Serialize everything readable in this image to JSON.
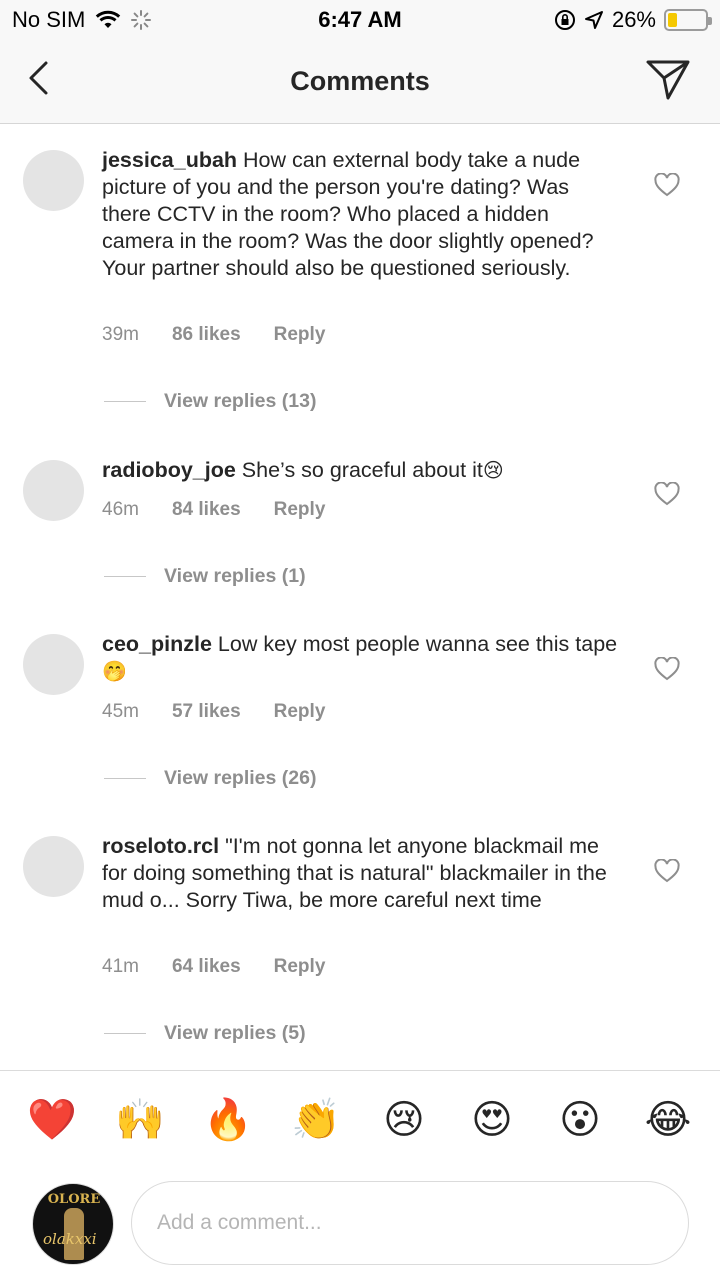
{
  "status_bar": {
    "carrier": "No SIM",
    "time": "6:47 AM",
    "battery": "26%",
    "battery_level": 0.26,
    "icons": [
      "wifi-icon",
      "loading-spinner-icon",
      "orientation-lock-icon",
      "location-arrow-icon",
      "battery-icon"
    ]
  },
  "nav": {
    "title": "Comments",
    "back_icon": "chevron-left-icon",
    "send_icon": "paper-plane-icon"
  },
  "comments": [
    {
      "username": "jessica_ubah",
      "text": "How can external body take a nude picture of you and the person you're dating? Was there CCTV in the room? Who placed a hidden camera in the room? Was the door slightly opened? Your partner should also be questioned seriously.",
      "emoji": "",
      "time": "39m",
      "likes": "86 likes",
      "reply": "Reply",
      "view_replies": "View replies (13)"
    },
    {
      "username": "radioboy_joe",
      "text": "She’s so graceful about it",
      "emoji": "😢",
      "time": "46m",
      "likes": "84 likes",
      "reply": "Reply",
      "view_replies": "View replies (1)"
    },
    {
      "username": "ceo_pinzle",
      "text": "Low key most people wanna see this tape",
      "emoji": "🤭",
      "time": "45m",
      "likes": "57 likes",
      "reply": "Reply",
      "view_replies": "View replies (26)"
    },
    {
      "username": "roseloto.rcl",
      "text": "\"I'm not gonna let anyone blackmail me for doing something that is natural\" blackmailer in the mud o... Sorry Tiwa, be more careful next time",
      "emoji": "",
      "time": "41m",
      "likes": "64 likes",
      "reply": "Reply",
      "view_replies": "View replies (5)"
    }
  ],
  "emoji_bar": [
    "❤️",
    "🙌",
    "🔥",
    "👏",
    "😢",
    "😍",
    "😮",
    "😂"
  ],
  "composer": {
    "avatar_text": "OLORE",
    "avatar_signature": "olakxxi",
    "placeholder": "Add a comment..."
  }
}
